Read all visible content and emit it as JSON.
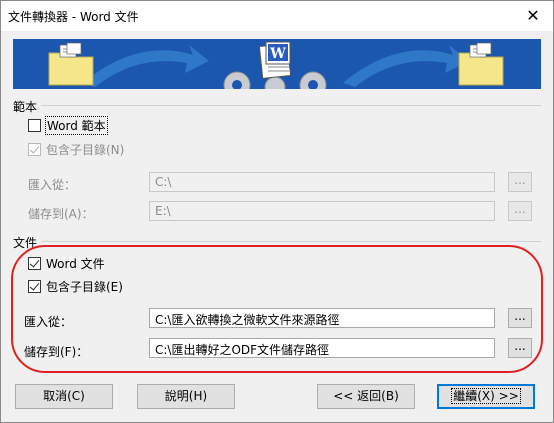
{
  "window": {
    "title": "文件轉換器 - Word 文件",
    "close_symbol": "✕"
  },
  "banner": {
    "colors": {
      "background": "#1b57ae",
      "arrow": "#2f78c8",
      "folder": "#f5e68c",
      "gear": "#c8ccd2"
    },
    "icons": [
      "folder-icon",
      "arrow-icon",
      "gear-icon",
      "word-document-icon",
      "arrow-icon",
      "folder-icon"
    ]
  },
  "templates": {
    "group_label": "範本",
    "checkbox_label": "Word 範本",
    "include_subdirs_label": "包含子目錄(N)",
    "import_from_label": "匯入從：",
    "import_from_value": "C:\\",
    "save_to_label": "儲存到(A)：",
    "save_to_value": "E:\\",
    "browse_label": "..."
  },
  "documents": {
    "group_label": "文件",
    "checkbox_label": "Word 文件",
    "include_subdirs_label": "包含子目錄(E)",
    "import_from_label": "匯入從：",
    "import_from_value": "C:\\匯入欲轉換之微軟文件來源路徑",
    "save_to_label": "儲存到(F)：",
    "save_to_value": "C:\\匯出轉好之ODF文件儲存路徑",
    "browse_label": "..."
  },
  "buttons": {
    "cancel": "取消(C)",
    "help": "說明(H)",
    "back": "<< 返回(B)",
    "next": "繼續(X) >>"
  },
  "colors": {
    "highlight": "#e02020",
    "default_button_border": "#0078d7"
  }
}
